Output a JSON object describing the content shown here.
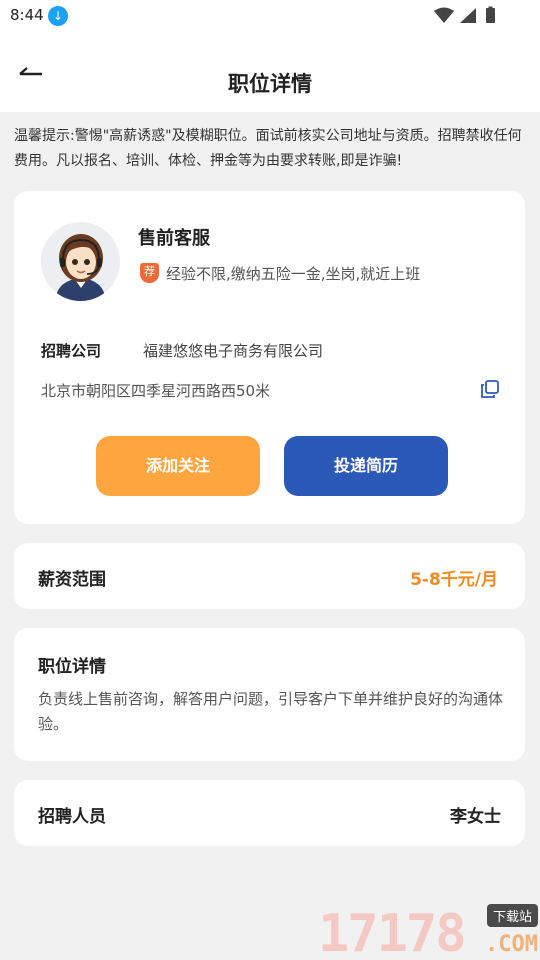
{
  "status_bar": {
    "time": "8:44"
  },
  "navbar": {
    "title": "职位详情"
  },
  "notice": "温馨提示:警惕\"高薪诱惑\"及模糊职位。面试前核实公司地址与资质。招聘禁收任何费用。凡以报名、培训、体检、押金等为由要求转账,即是诈骗!",
  "job": {
    "title": "售前客服",
    "tag_icon": "荐",
    "tags": "经验不限,缴纳五险一金,坐岗,就近上班",
    "company_label": "招聘公司",
    "company_name": "福建悠悠电子商务有限公司",
    "address": "北京市朝阳区四季星河西路西50米",
    "follow_button": "添加关注",
    "apply_button": "投递简历"
  },
  "salary": {
    "label": "薪资范围",
    "value": "5-8千元/月"
  },
  "detail": {
    "title": "职位详情",
    "text": "负责线上售前咨询，解答用户问题，引导客户下单并维护良好的沟通体验。"
  },
  "recruiter": {
    "label": "招聘人员",
    "name": "李女士"
  },
  "watermark": {
    "number": "17178",
    "tag": "下载站",
    "suffix": ".COM"
  },
  "colors": {
    "accent_orange": "#fda640",
    "primary_blue": "#2b59b8",
    "salary": "#f28a1e"
  }
}
